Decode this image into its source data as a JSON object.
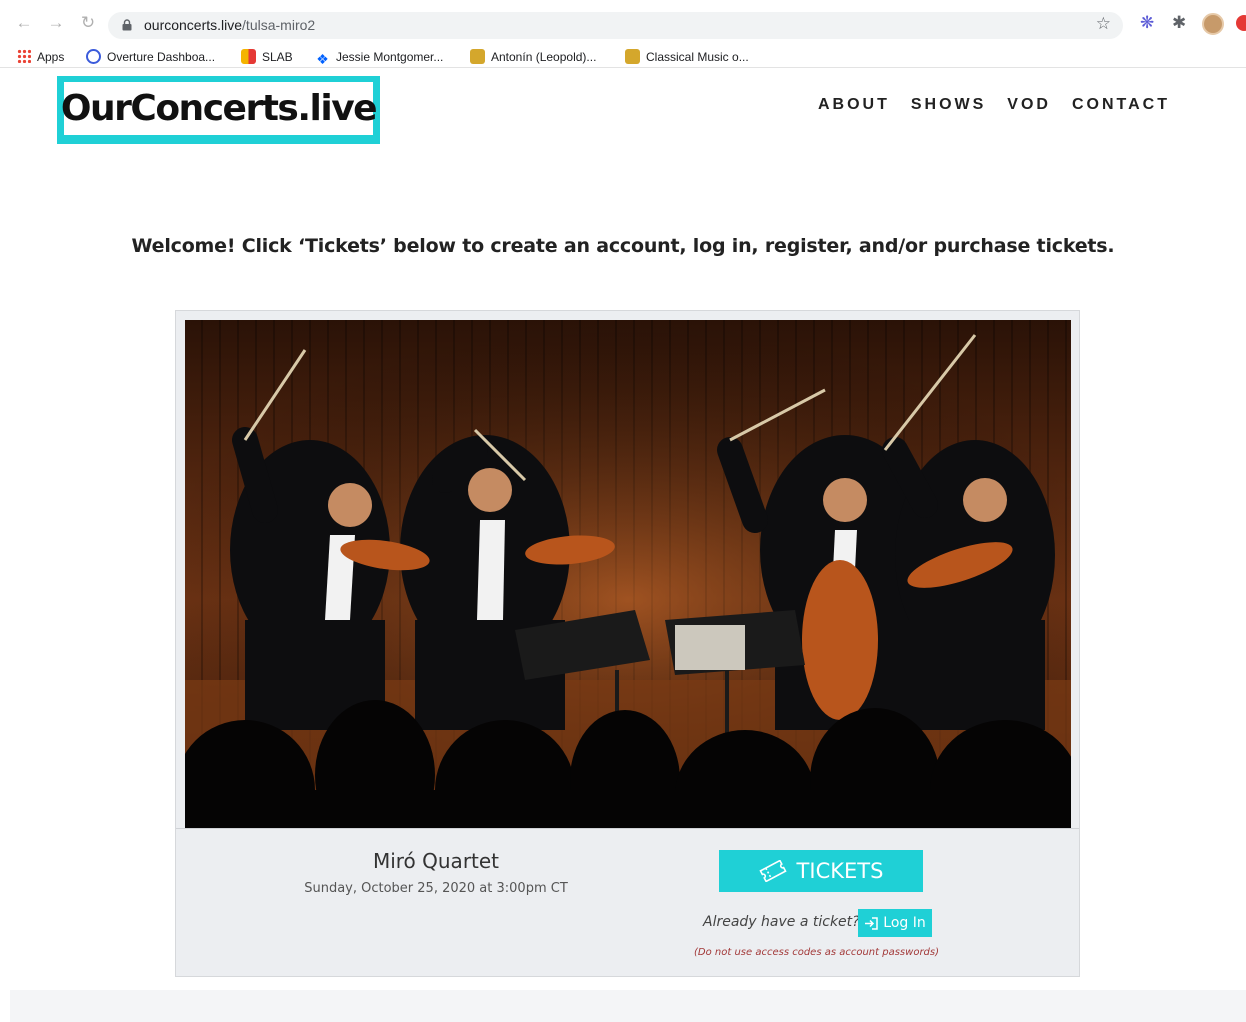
{
  "browser": {
    "url_domain": "ourconcerts.live",
    "url_path": "/tulsa-miro2",
    "bookmarks": [
      {
        "label": "Apps",
        "icon": "apps-grid-icon"
      },
      {
        "label": "Overture Dashboa...",
        "icon": "overture-icon"
      },
      {
        "label": "SLAB",
        "icon": "slab-icon"
      },
      {
        "label": "Jessie Montgomer...",
        "icon": "dropbox-icon"
      },
      {
        "label": "Antonín (Leopold)...",
        "icon": "music-icon"
      },
      {
        "label": "Classical Music o...",
        "icon": "music-icon"
      }
    ]
  },
  "site": {
    "logo_text": "OurConcerts.live",
    "nav": [
      "ABOUT",
      "SHOWS",
      "VOD",
      "CONTACT"
    ],
    "welcome": "Welcome! Click ‘Tickets’ below to create an account, log in, register, and/or purchase tickets."
  },
  "event": {
    "name": "Miró Quartet",
    "datetime": "Sunday, October 25, 2020 at 3:00pm CT",
    "tickets_label": "TICKETS",
    "have_ticket": "Already have a ticket?",
    "login_label": "Log In",
    "note": "(Do not use access codes as account passwords)"
  },
  "colors": {
    "accent": "#1fd0d6",
    "note": "#a33a3a"
  }
}
